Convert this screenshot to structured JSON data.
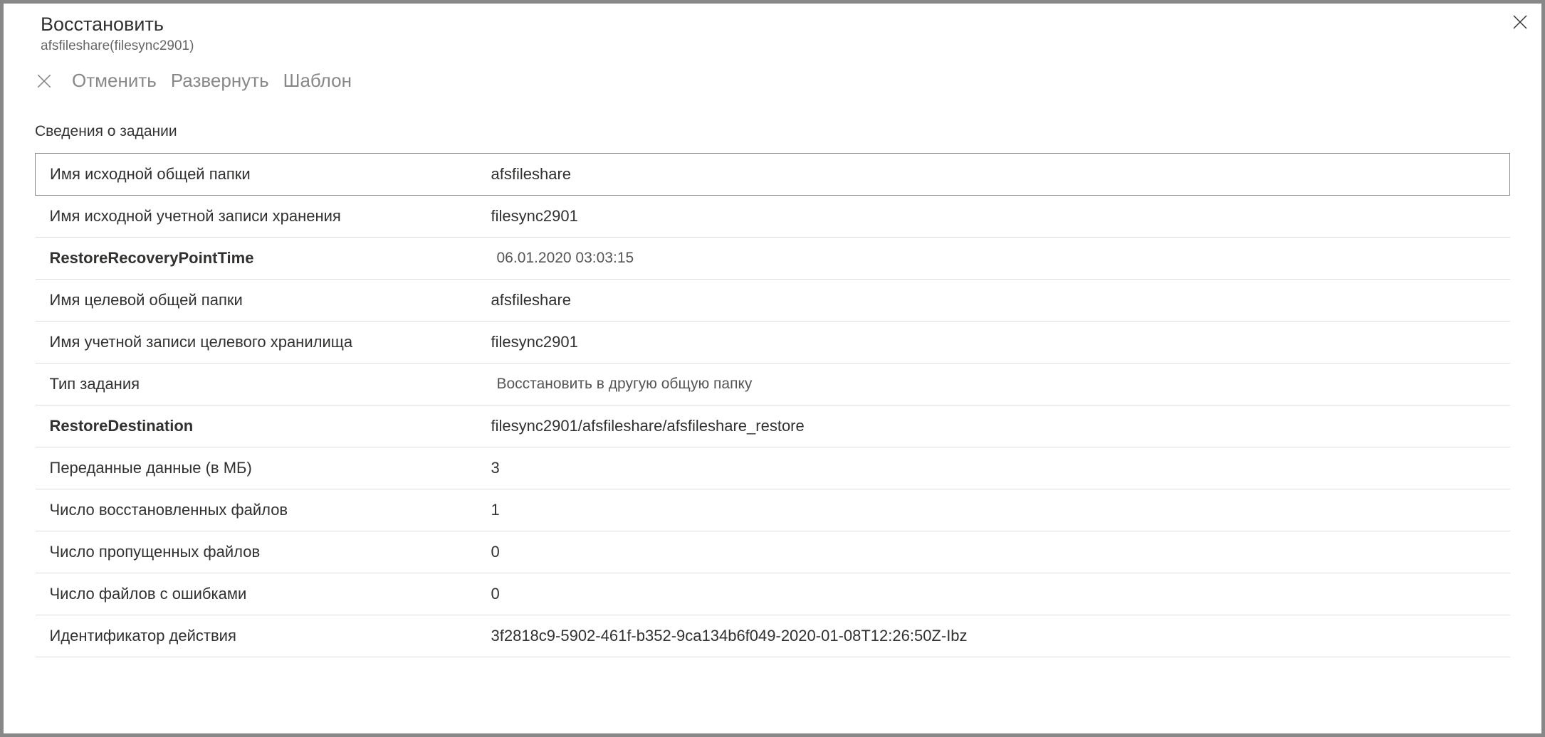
{
  "header": {
    "title": "Восстановить",
    "subtitle": "afsfileshare(filesync2901)"
  },
  "toolbar": {
    "cancel": "Отменить",
    "expand": "Развернуть",
    "template": "Шаблон"
  },
  "section_title": "Сведения о задании",
  "details": [
    {
      "label": "Имя исходной общей папки",
      "value": "afsfileshare",
      "bold": false,
      "highlighted": true
    },
    {
      "label": "Имя исходной учетной записи хранения",
      "value": "filesync2901",
      "bold": false,
      "highlighted": false
    },
    {
      "label": "RestoreRecoveryPointTime",
      "value": "06.01.2020 03:03:15",
      "bold": true,
      "highlighted": false,
      "muted": true
    },
    {
      "label": "Имя целевой общей папки",
      "value": "afsfileshare",
      "bold": false,
      "highlighted": false
    },
    {
      "label": "Имя учетной записи целевого хранилища",
      "value": "filesync2901",
      "bold": false,
      "highlighted": false
    },
    {
      "label": "Тип задания",
      "value": "Восстановить в другую общую папку",
      "bold": false,
      "highlighted": false,
      "muted": true
    },
    {
      "label": "RestoreDestination",
      "value": "filesync2901/afsfileshare/afsfileshare_restore",
      "bold": true,
      "highlighted": false
    },
    {
      "label": "Переданные данные (в МБ)",
      "value": "3",
      "bold": false,
      "highlighted": false
    },
    {
      "label": "Число восстановленных файлов",
      "value": "1",
      "bold": false,
      "highlighted": false
    },
    {
      "label": "Число пропущенных файлов",
      "value": "0",
      "bold": false,
      "highlighted": false
    },
    {
      "label": "Число файлов с ошибками",
      "value": "0",
      "bold": false,
      "highlighted": false
    },
    {
      "label": "Идентификатор действия",
      "value": "3f2818c9-5902-461f-b352-9ca134b6f049-2020-01-08T12:26:50Z-Ibz",
      "bold": false,
      "highlighted": false
    }
  ]
}
